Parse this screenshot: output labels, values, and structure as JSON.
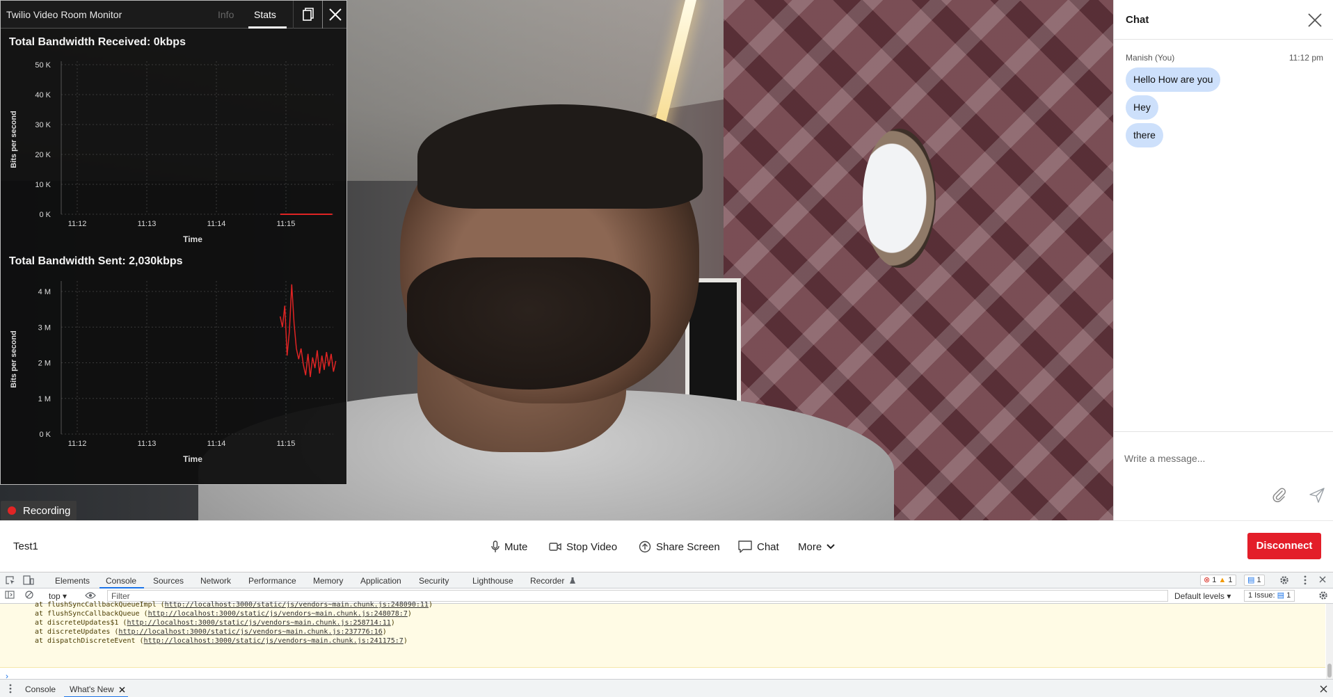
{
  "monitor": {
    "title": "Twilio Video Room Monitor",
    "tabs": {
      "info": "Info",
      "stats": "Stats"
    },
    "active_tab": "Stats"
  },
  "charts": [
    {
      "title": "Total Bandwidth Received: 0kbps",
      "ylabel": "Bits per second",
      "xlabel": "Time",
      "yticks": [
        "50 K",
        "40 K",
        "30 K",
        "20 K",
        "10 K",
        "0 K"
      ],
      "xticks": [
        "11:12",
        "11:13",
        "11:14",
        "11:15"
      ]
    },
    {
      "title": "Total Bandwidth Sent: 2,030kbps",
      "ylabel": "Bits per second",
      "xlabel": "Time",
      "yticks": [
        "4 M",
        "3 M",
        "2 M",
        "1 M",
        "0 K"
      ],
      "xticks": [
        "11:12",
        "11:13",
        "11:14",
        "11:15"
      ]
    }
  ],
  "chart_data": [
    {
      "type": "line",
      "title": "Total Bandwidth Received: 0kbps",
      "xlabel": "Time",
      "ylabel": "Bits per second",
      "ylim": [
        0,
        50000
      ],
      "x_ticks": [
        "11:12",
        "11:13",
        "11:14",
        "11:15"
      ],
      "series": [
        {
          "color": "#e02424",
          "x": [
            "11:14:55",
            "11:15:10",
            "11:15:25",
            "11:15:40"
          ],
          "values": [
            0,
            0,
            0,
            0
          ]
        }
      ]
    },
    {
      "type": "line",
      "title": "Total Bandwidth Sent: 2,030kbps",
      "xlabel": "Time",
      "ylabel": "Bits per second",
      "ylim": [
        0,
        4000000
      ],
      "x_ticks": [
        "11:12",
        "11:13",
        "11:14",
        "11:15"
      ],
      "series": [
        {
          "color": "#e02424",
          "x": [
            "11:14:55",
            "11:14:57",
            "11:14:59",
            "11:15:01",
            "11:15:03",
            "11:15:05",
            "11:15:07",
            "11:15:09",
            "11:15:11",
            "11:15:13",
            "11:15:15",
            "11:15:17",
            "11:15:19",
            "11:15:21",
            "11:15:23",
            "11:15:25",
            "11:15:27",
            "11:15:29",
            "11:15:31",
            "11:15:33",
            "11:15:35",
            "11:15:37",
            "11:15:39",
            "11:15:41",
            "11:15:43"
          ],
          "values": [
            3300000,
            3000000,
            3600000,
            2200000,
            2900000,
            4200000,
            3100000,
            2400000,
            2100000,
            2400000,
            1950000,
            1650000,
            2250000,
            1600000,
            2150000,
            1850000,
            2350000,
            1700000,
            2200000,
            1800000,
            2300000,
            1900000,
            2250000,
            1750000,
            2050000
          ]
        }
      ]
    }
  ],
  "recording": {
    "label": "Recording"
  },
  "chat": {
    "title": "Chat",
    "author": "Manish (You)",
    "time": "11:12 pm",
    "messages": [
      "Hello How are you",
      "Hey",
      "there"
    ],
    "input_placeholder": "Write a message..."
  },
  "controls": {
    "room_name": "Test1",
    "mute": "Mute",
    "stop_video": "Stop Video",
    "share_screen": "Share Screen",
    "chat": "Chat",
    "more": "More",
    "disconnect": "Disconnect"
  },
  "devtools": {
    "tabs": [
      "Elements",
      "Console",
      "Sources",
      "Network",
      "Performance",
      "Memory",
      "Application",
      "Security",
      "Lighthouse",
      "Recorder"
    ],
    "active_tab": "Console",
    "counts": {
      "errors": "1",
      "warnings": "1",
      "messages": "1"
    },
    "context": "top",
    "filter_placeholder": "Filter",
    "levels": "Default levels",
    "issues_label": "1 Issue:",
    "issues_count": "1",
    "log_lines": [
      {
        "prefix": "at flushSyncCallbackQueueImpl (",
        "link": "http://localhost:3000/static/js/vendors~main.chunk.js:248090:11",
        "suffix": ")"
      },
      {
        "prefix": "at flushSyncCallbackQueue (",
        "link": "http://localhost:3000/static/js/vendors~main.chunk.js:248078:7",
        "suffix": ")"
      },
      {
        "prefix": "at discreteUpdates$1 (",
        "link": "http://localhost:3000/static/js/vendors~main.chunk.js:258714:11",
        "suffix": ")"
      },
      {
        "prefix": "at discreteUpdates (",
        "link": "http://localhost:3000/static/js/vendors~main.chunk.js:237776:16",
        "suffix": ")"
      },
      {
        "prefix": "at dispatchDiscreteEvent (",
        "link": "http://localhost:3000/static/js/vendors~main.chunk.js:241175:7",
        "suffix": ")"
      }
    ],
    "drawer_tabs": [
      "Console",
      "What's New"
    ],
    "drawer_active": "What's New"
  }
}
